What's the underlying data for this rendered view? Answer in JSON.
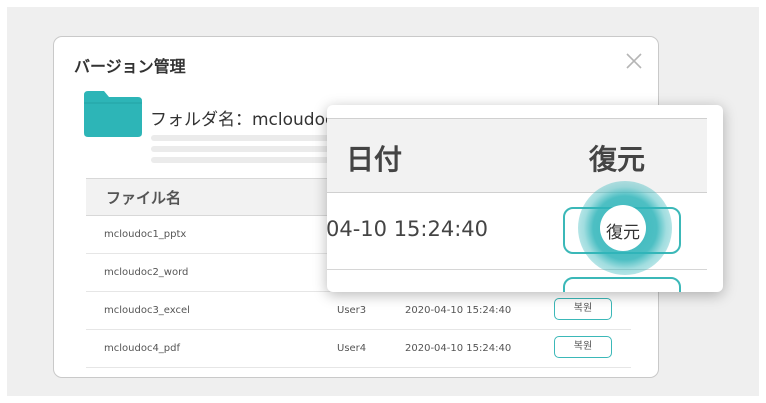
{
  "dialog": {
    "title": "バージョン管理",
    "folder_label": "フォルダ名：mcloudoc"
  },
  "table": {
    "header_name": "ファイル名",
    "rows": [
      {
        "name": "mcloudoc1_pptx",
        "user": "",
        "date": "",
        "action": ""
      },
      {
        "name": "mcloudoc2_word",
        "user": "",
        "date": "",
        "action": ""
      },
      {
        "name": "mcloudoc3_excel",
        "user": "User3",
        "date": "2020-04-10  15:24:40",
        "action": "복원"
      },
      {
        "name": "mcloudoc4_pdf",
        "user": "User4",
        "date": "2020-04-10  15:24:40",
        "action": "복원"
      }
    ]
  },
  "zoom": {
    "header_date": "日付",
    "header_restore": "復元",
    "row1_date": "04-10   15:24:40",
    "row1_action": "復元"
  },
  "colors": {
    "accent": "#2fb6b9",
    "folder": "#2db5b7"
  }
}
